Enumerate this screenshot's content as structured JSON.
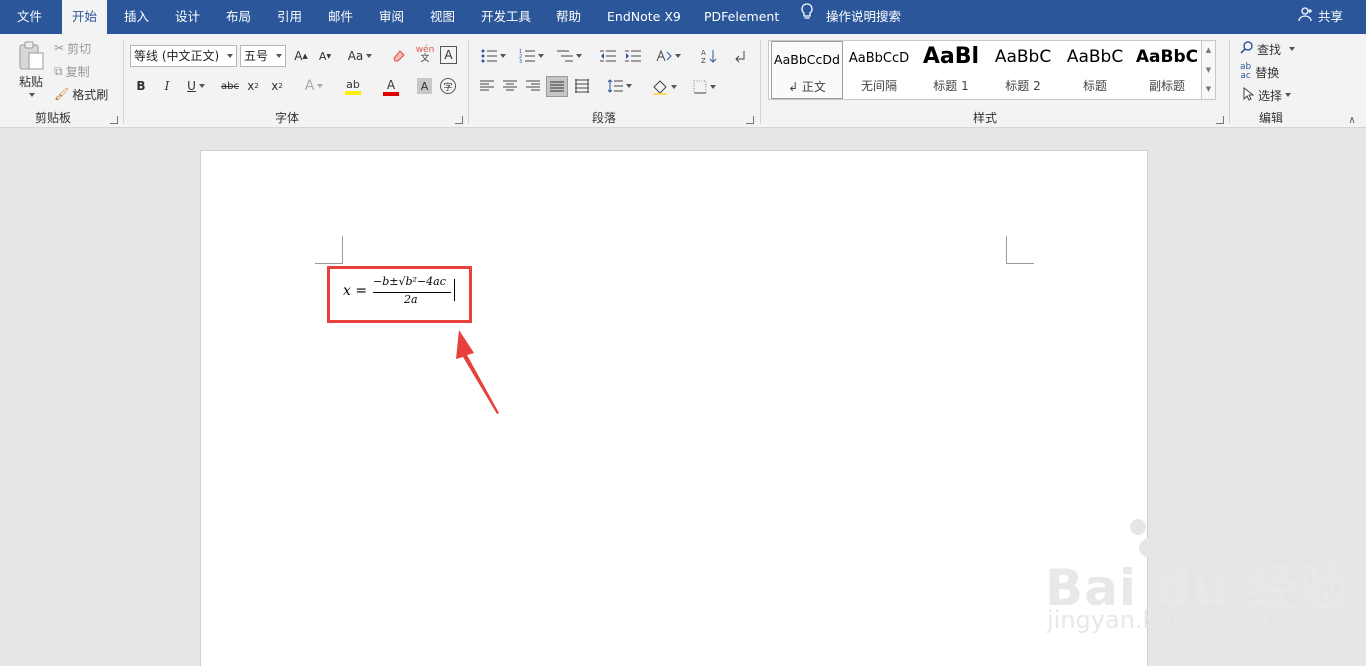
{
  "tabs": [
    {
      "label": "文件"
    },
    {
      "label": "开始"
    },
    {
      "label": "插入"
    },
    {
      "label": "设计"
    },
    {
      "label": "布局"
    },
    {
      "label": "引用"
    },
    {
      "label": "邮件"
    },
    {
      "label": "审阅"
    },
    {
      "label": "视图"
    },
    {
      "label": "开发工具"
    },
    {
      "label": "帮助"
    },
    {
      "label": "EndNote X9"
    },
    {
      "label": "PDFelement"
    },
    {
      "label": "操作说明搜索"
    }
  ],
  "share_label": "共享",
  "clipboard": {
    "paste": "粘贴",
    "cut": "剪切",
    "copy": "复制",
    "format_painter": "格式刷",
    "group": "剪贴板"
  },
  "font": {
    "name": "等线 (中文正文)",
    "size": "五号",
    "group": "字体",
    "change_case": "Aa",
    "highlight": "ab",
    "clear": "A"
  },
  "paragraph": {
    "group": "段落"
  },
  "styles": {
    "group": "样式",
    "items": [
      {
        "preview": "AaBbCcDd",
        "name": "↲ 正文"
      },
      {
        "preview": "AaBbCcD",
        "name": "无间隔"
      },
      {
        "preview": "AaBl",
        "name": "标题 1"
      },
      {
        "preview": "AaBbC",
        "name": "标题 2"
      },
      {
        "preview": "AaBbC",
        "name": "标题"
      },
      {
        "preview": "AaBbC",
        "name": "副标题"
      }
    ]
  },
  "editing": {
    "find": "查找",
    "replace": "替换",
    "select": "选择",
    "group": "编辑"
  },
  "equation": {
    "lhs": "x =",
    "numerator": "−b±√b²−4ac",
    "denominator": "2a"
  },
  "colors": {
    "accent": "#2b579a",
    "highlight_box": "#e8403c",
    "arrow": "#e8403c"
  },
  "watermark": {
    "brand": "Bai du 经验",
    "url": "jingyan.baidu.com"
  }
}
